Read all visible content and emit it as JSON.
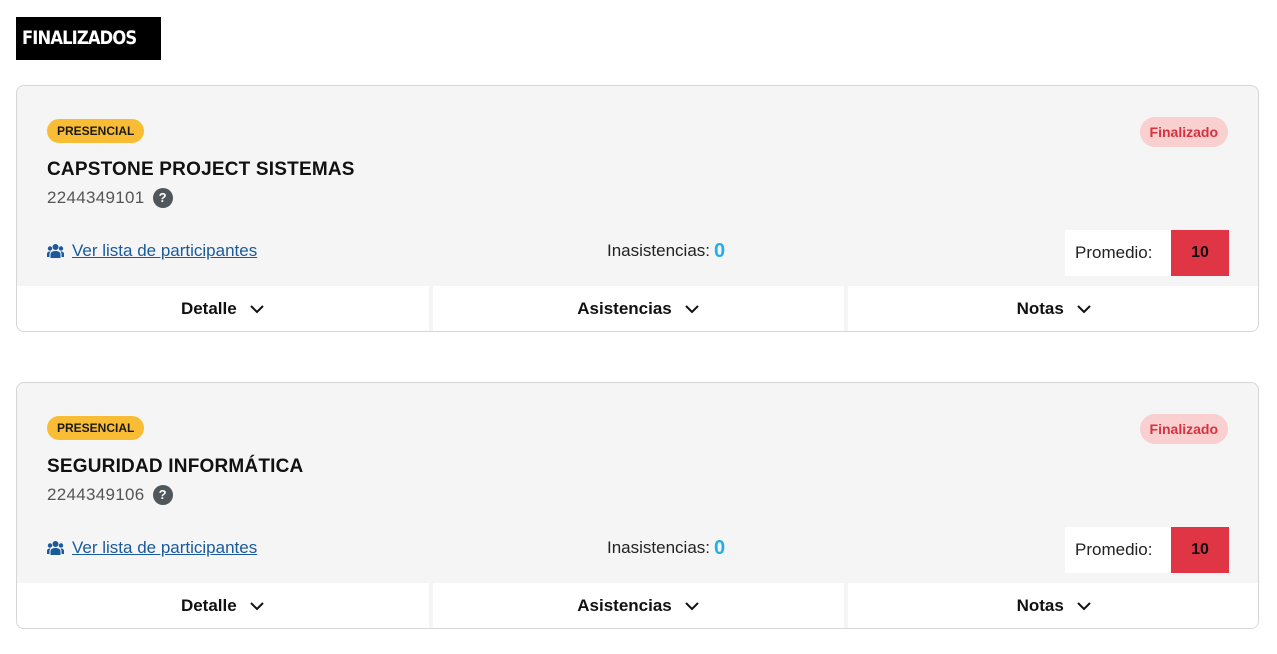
{
  "section": {
    "title": "FINALIZADOS"
  },
  "courses": [
    {
      "modality": "PRESENCIAL",
      "status": "Finalizado",
      "name": "CAPSTONE PROJECT SISTEMAS",
      "code": "2244349101",
      "participants_link": "Ver lista de participantes",
      "absences_label": "Inasistencias:",
      "absences_value": "0",
      "average_label": "Promedio:",
      "average_value": "10",
      "tabs": {
        "detail": "Detalle",
        "attendance": "Asistencias",
        "grades": "Notas"
      }
    },
    {
      "modality": "PRESENCIAL",
      "status": "Finalizado",
      "name": "SEGURIDAD INFORMÁTICA",
      "code": "2244349106",
      "participants_link": "Ver lista de participantes",
      "absences_label": "Inasistencias:",
      "absences_value": "0",
      "average_label": "Promedio:",
      "average_value": "10",
      "tabs": {
        "detail": "Detalle",
        "attendance": "Asistencias",
        "grades": "Notas"
      }
    }
  ],
  "icons": {
    "help": "question-circle-icon",
    "participants": "users-icon",
    "expand": "chevron-down-icon"
  },
  "colors": {
    "modality_badge": "#f9bd35",
    "status_badge_bg": "#f9cfcf",
    "status_badge_text": "#d6323f",
    "average_value_bg": "#e03544",
    "absences_value": "#22aee8",
    "link": "#1a5a9c"
  }
}
